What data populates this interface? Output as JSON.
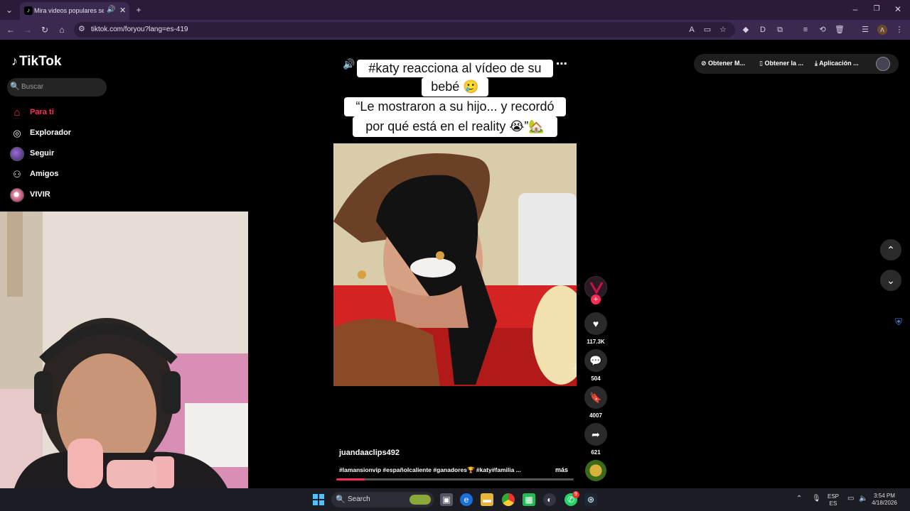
{
  "browser": {
    "tab_title": "Mira videos populares sele",
    "url": "tiktok.com/foryou?lang=es-419"
  },
  "sidebar": {
    "logo_text": "TikTok",
    "search_placeholder": "Buscar",
    "items": [
      {
        "label": "Para ti",
        "icon": "home-icon",
        "active": true
      },
      {
        "label": "Explorador",
        "icon": "compass-icon"
      },
      {
        "label": "Seguir",
        "icon": "avatar-icon"
      },
      {
        "label": "Amigos",
        "icon": "friends-icon"
      },
      {
        "label": "VIVIR",
        "icon": "live-icon"
      }
    ]
  },
  "video": {
    "caption_line1": "#katy reacciona al vídeo de su",
    "caption_line2": "bebé 🥲",
    "caption_line3": "“Le mostraron a su hijo... y recordó",
    "caption_line4": "por qué está en el reality 😭”🏡",
    "author": "juandaaclips492",
    "hashtags": "#lamansionvip #españolcaliente #ganadores🏆 #katy#familia ...",
    "more_label": "más",
    "progress": 0.12
  },
  "actions": {
    "likes": "117.3K",
    "comments": "504",
    "saves": "4007",
    "shares": "621"
  },
  "top_right": {
    "item1": "Obtener M...",
    "item2": "Obtener la ...",
    "item3": "Aplicación ..."
  },
  "taskbar": {
    "search_label": "Search",
    "lang_top": "ESP",
    "lang_bottom": "ES",
    "time": "3:54 PM",
    "date": "4/18/2026",
    "whatsapp_badge": "9"
  },
  "colors": {
    "accent": "#fe2c55",
    "chrome_bg": "#3b2a50",
    "tabbar_bg": "#2b1b3a"
  }
}
